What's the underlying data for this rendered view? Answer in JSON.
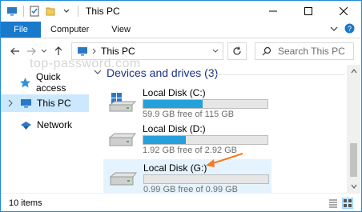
{
  "window": {
    "title": "This PC",
    "minimize_label": "minimize",
    "maximize_label": "maximize",
    "close_label": "close"
  },
  "ribbon": {
    "tabs": [
      {
        "label": "File"
      },
      {
        "label": "Computer"
      },
      {
        "label": "View"
      }
    ]
  },
  "address_bar": {
    "path": "This PC"
  },
  "search": {
    "placeholder": "Search This PC"
  },
  "watermark": "top-password.com",
  "sidebar": {
    "items": [
      {
        "label": "Quick access",
        "icon": "star-icon"
      },
      {
        "label": "This PC",
        "icon": "computer-icon",
        "selected": true
      },
      {
        "label": "Network",
        "icon": "network-icon"
      }
    ]
  },
  "content": {
    "group_title": "Devices and drives (3)",
    "drives": [
      {
        "name": "Local Disk (C:)",
        "free_text": "59.9 GB free of 115 GB",
        "used_fraction": 0.48,
        "icon": "windows-drive-icon"
      },
      {
        "name": "Local Disk (D:)",
        "free_text": "1.92 GB free of 2.92 GB",
        "used_fraction": 0.34,
        "icon": "hard-drive-icon"
      },
      {
        "name": "Local Disk (G:)",
        "free_text": "0.99 GB free of 0.99 GB",
        "used_fraction": 0.0,
        "icon": "hard-drive-icon",
        "selected": true
      }
    ]
  },
  "status": {
    "items_count": "10 items"
  },
  "colors": {
    "accent": "#1979ca",
    "bar_fill": "#26a0da",
    "selection": "#cce8ff",
    "group_header": "#1e3287",
    "annotation_arrow": "#f47b20"
  }
}
